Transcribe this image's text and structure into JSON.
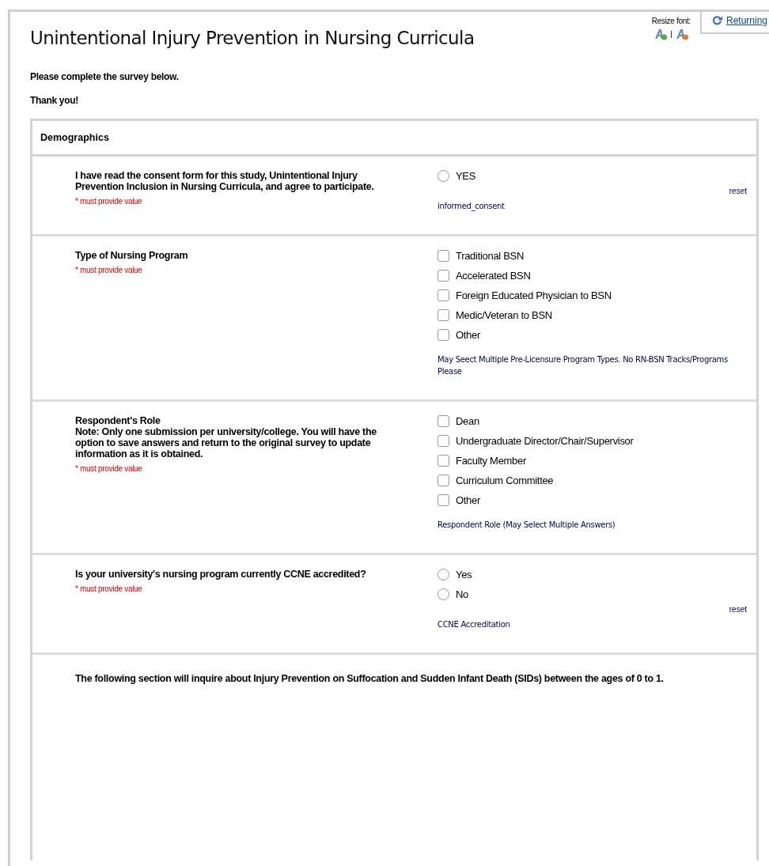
{
  "header": {
    "title": "Unintentional Injury Prevention in Nursing Curricula",
    "resize_font_label": "Resize font:",
    "returning_link": "Returning"
  },
  "intro": [
    "Please complete the survey below.",
    "Thank you!"
  ],
  "section": {
    "title": "Demographics"
  },
  "questions": [
    {
      "kind": "radio",
      "label": "I have read the consent form for this study, Unintentional Injury Prevention Inclusion in Nursing Curricula, and agree to participate.",
      "required_note": "* must provide value",
      "options": [
        {
          "label": "YES",
          "selected": false
        }
      ],
      "reset": "reset",
      "field_note": "informed_consent"
    },
    {
      "kind": "checkbox",
      "label": "Type of Nursing Program",
      "required_note": "* must provide value",
      "options": [
        {
          "label": "Traditional BSN",
          "checked": false
        },
        {
          "label": "Accelerated BSN",
          "checked": false
        },
        {
          "label": "Foreign Educated Physician to BSN",
          "checked": false
        },
        {
          "label": "Medic/Veteran to BSN",
          "checked": false
        },
        {
          "label": "Other",
          "checked": false
        }
      ],
      "field_note": "May Seect Multiple Pre-Licensure Program Types. No RN-BSN Tracks/Programs Please"
    },
    {
      "kind": "checkbox",
      "label": "Respondent's Role",
      "note": "Note: Only one submission per university/college. You will have the option to save answers and return to the original survey to update information as it is obtained.",
      "required_note": "* must provide value",
      "options": [
        {
          "label": "Dean",
          "checked": false
        },
        {
          "label": "Undergraduate Director/Chair/Supervisor",
          "checked": false
        },
        {
          "label": "Faculty Member",
          "checked": false
        },
        {
          "label": "Curriculum Committee",
          "checked": false
        },
        {
          "label": "Other",
          "checked": false
        }
      ],
      "field_note": "Respondent Role (May Select Multiple Answers)"
    },
    {
      "kind": "radio",
      "label": "Is your university's nursing program currently CCNE accredited?",
      "required_note": "* must provide value",
      "options": [
        {
          "label": "Yes",
          "selected": false
        },
        {
          "label": "No",
          "selected": false
        }
      ],
      "reset": "reset",
      "field_note": "CCNE Accreditation"
    },
    {
      "kind": "description",
      "label": "The following section will inquire about Injury Prevention on Suffocation and Sudden Infant Death (SIDs) between the ages of 0 to 1."
    }
  ]
}
